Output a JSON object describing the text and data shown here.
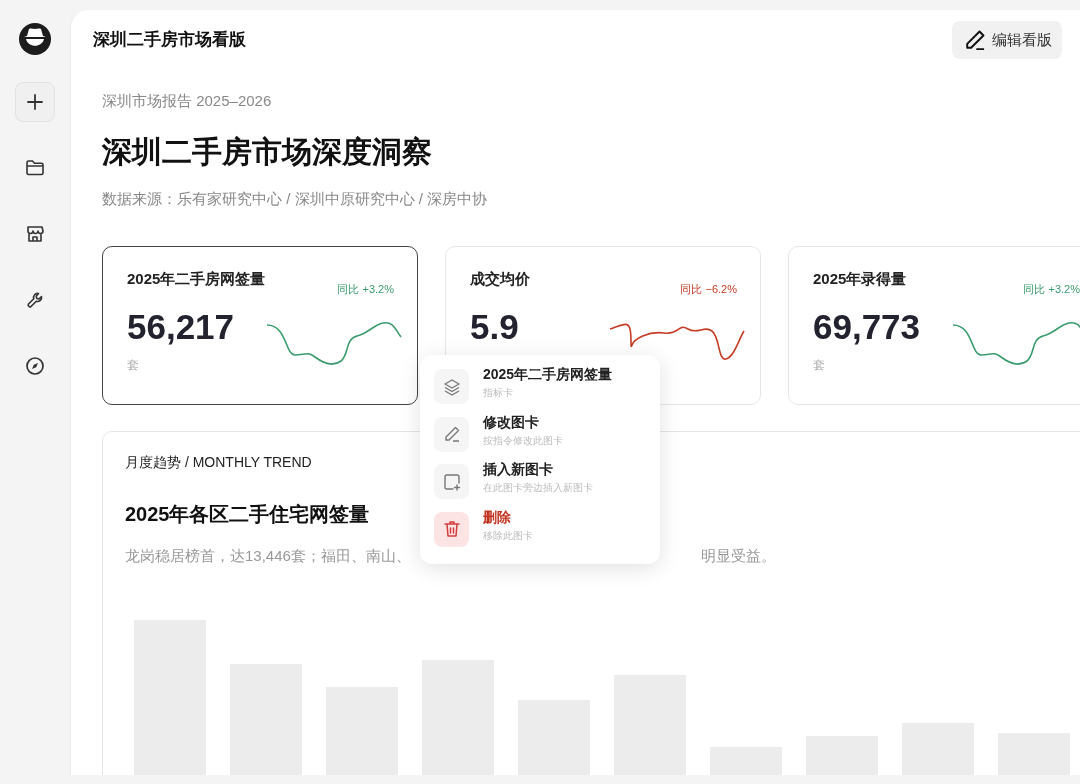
{
  "header": {
    "title": "深圳二手房市场看版",
    "edit_button": "编辑看版"
  },
  "report": {
    "eyebrow": "深圳市场报告 2025–2026",
    "title": "深圳二手房市场深度洞察",
    "source": "数据来源：乐有家研究中心 / 深圳中原研究中心 / 深房中协"
  },
  "kpis": [
    {
      "title": "2025年二手房网签量",
      "change": "同比 +3.2%",
      "color": "#3a9c6e",
      "value": "56,217",
      "unit": "套",
      "selected": true
    },
    {
      "title": "成交均价",
      "change": "同比 −6.2%",
      "color": "#c53d26",
      "value": "5.9",
      "selected": false
    },
    {
      "title": "2025年录得量",
      "change": "同比 +3.2%",
      "color": "#3a9c6e",
      "value": "69,773",
      "unit": "套",
      "selected": false
    }
  ],
  "chart_card": {
    "eyebrow": "月度趋势 / MONTHLY TREND",
    "title": "2025年各区二手住宅网签量",
    "description_parts": [
      "龙岗稳居榜首，达13,446套；福田、南山、",
      "明显受益。"
    ]
  },
  "context_menu": {
    "items": [
      {
        "kind": "normal",
        "title": "2025年二手房网签量",
        "subtitle": "指标卡"
      },
      {
        "kind": "normal",
        "title": "修改图卡",
        "subtitle": "按指令修改此图卡"
      },
      {
        "kind": "normal",
        "title": "插入新图卡",
        "subtitle": "在此图卡旁边插入新图卡"
      },
      {
        "kind": "danger",
        "title": "删除",
        "subtitle": "移除此图卡"
      }
    ]
  }
}
